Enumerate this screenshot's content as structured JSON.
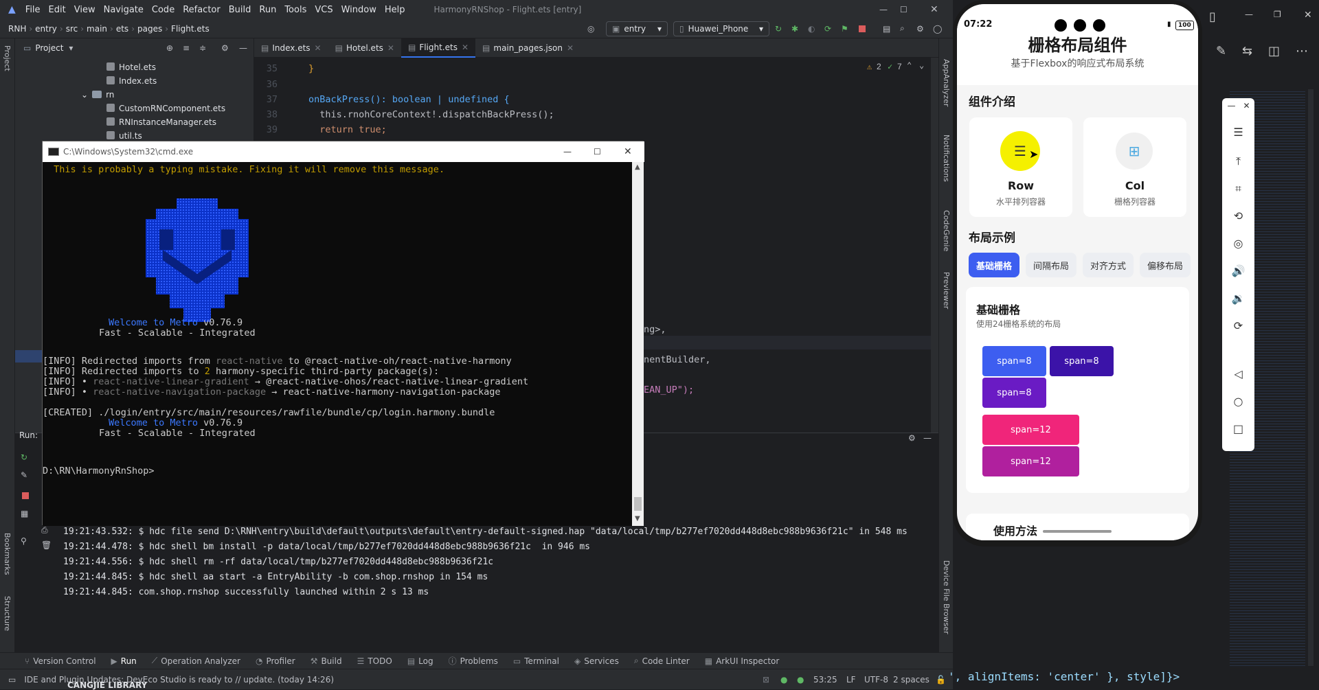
{
  "ide": {
    "window_title": "HarmonyRNShop - Flight.ets [entry]",
    "menu": [
      "File",
      "Edit",
      "View",
      "Navigate",
      "Code",
      "Refactor",
      "Build",
      "Run",
      "Tools",
      "VCS",
      "Window",
      "Help"
    ],
    "breadcrumb": [
      "RNH",
      "entry",
      "src",
      "main",
      "ets",
      "pages",
      "Flight.ets"
    ],
    "run_config": "entry",
    "device": "Huawei_Phone",
    "project_label": "Project",
    "tree": [
      {
        "name": "Hotel.ets",
        "type": "file"
      },
      {
        "name": "Index.ets",
        "type": "file"
      },
      {
        "name": "rn",
        "type": "dir"
      },
      {
        "name": "CustomRNComponent.ets",
        "type": "file"
      },
      {
        "name": "RNInstanceManager.ets",
        "type": "file"
      },
      {
        "name": "util.ts",
        "type": "file"
      }
    ],
    "tabs": [
      "Index.ets",
      "Hotel.ets",
      "Flight.ets",
      "main_pages.json"
    ],
    "active_tab": "Flight.ets",
    "inspection": {
      "warnings": "2",
      "ok": "7"
    },
    "code": [
      {
        "ln": "35",
        "text": "}"
      },
      {
        "ln": "36",
        "text": ""
      },
      {
        "ln": "37",
        "text": "onBackPress(): boolean | undefined {"
      },
      {
        "ln": "38",
        "text": "  this.rnohCoreContext!.dispatchBackPress();"
      },
      {
        "ln": "39",
        "text": "  return true;"
      }
    ],
    "code_fragments": [
      "ng>,",
      "nentBuilder,",
      "EAN_UP\");"
    ],
    "run_label": "Run:",
    "run_log": [
      "19:21:43.532: $ hdc file send D:\\RNH\\entry\\build\\default\\outputs\\default\\entry-default-signed.hap \"data/local/tmp/b277ef7020dd448d8ebc988b9636f21c\" in 548 ms",
      "19:21:44.478: $ hdc shell bm install -p data/local/tmp/b277ef7020dd448d8ebc988b9636f21c  in 946 ms",
      "19:21:44.556: $ hdc shell rm -rf data/local/tmp/b277ef7020dd448d8ebc988b9636f21c",
      "19:21:44.845: $ hdc shell aa start -a EntryAbility -b com.shop.rnshop in 154 ms",
      "19:21:44.845: com.shop.rnshop successfully launched within 2 s 13 ms"
    ],
    "bottom_tabs": [
      "Version Control",
      "Run",
      "Operation Analyzer",
      "Profiler",
      "Build",
      "TODO",
      "Log",
      "Problems",
      "Terminal",
      "Services",
      "Code Linter",
      "ArkUI Inspector"
    ],
    "right_strip": [
      "AppAnalyzer",
      "Notifications",
      "CodeGenie",
      "Previewer",
      "Device File Browser"
    ],
    "left_strip": [
      "Project",
      "Bookmarks",
      "Structure"
    ],
    "status": {
      "message": "IDE and Plugin Updates: DevEco Studio is ready to // update. (today 14:26)",
      "position": "53:25",
      "line_sep": "LF",
      "encoding": "UTF-8",
      "indent": "2 spaces"
    },
    "bottom_fragment": "CANGJIE LIBRARY"
  },
  "cmd": {
    "title": "C:\\Windows\\System32\\cmd.exe",
    "lines": {
      "warn": " This is probably a typing mistake. Fixing it will remove this message.",
      "welcome1_a": "Welcome to Metro",
      "welcome1_b": " v0.76.9",
      "fast1": "Fast - Scalable - Integrated",
      "info1_a": "[INFO] Redirected imports from ",
      "info1_b": "react-native",
      "info1_c": " to @react-native-oh/react-native-harmony",
      "info2_a": "[INFO] Redirected imports to ",
      "info2_b": "2",
      "info2_c": " harmony-specific third-party package(s):",
      "info3_a": "[INFO] • ",
      "info3_b": "react-native-linear-gradient",
      "info3_c": " → @react-native-ohos/react-native-linear-gradient",
      "info4_a": "[INFO] • ",
      "info4_b": "react-native-navigation-package",
      "info4_c": " → react-native-harmony-navigation-package",
      "created": "[CREATED] ./login/entry/src/main/resources/rawfile/bundle/cp/login.harmony.bundle",
      "welcome2_a": "Welcome to Metro",
      "welcome2_b": " v0.76.9",
      "fast2": "Fast - Scalable - Integrated",
      "prompt": "D:\\RN\\HarmonyRnShop>"
    }
  },
  "phone": {
    "time": "07:22",
    "battery": "100",
    "title": "栅格布局组件",
    "subtitle": "基于Flexbox的响应式布局系统",
    "intro_heading": "组件介绍",
    "intro_cards": [
      {
        "name": "Row",
        "desc": "水平排列容器"
      },
      {
        "name": "Col",
        "desc": "栅格列容器"
      }
    ],
    "examples_heading": "布局示例",
    "segments": [
      "基础栅格",
      "间隔布局",
      "对齐方式",
      "偏移布局"
    ],
    "active_segment": "基础栅格",
    "demo_title": "基础栅格",
    "demo_desc": "使用24栅格系统的布局",
    "blocks": [
      {
        "label": "span=8",
        "color": "#3d5ef0"
      },
      {
        "label": "span=8",
        "color": "#3b13a8"
      },
      {
        "label": "span=8",
        "color": "#6a1bc4"
      },
      {
        "label": "span=12",
        "color": "#f0257a"
      },
      {
        "label": "span=12",
        "color": "#b0209e"
      }
    ],
    "usage_heading": "使用方法"
  },
  "desktop": {
    "code_fragment": "', alignItems: 'center' }, style]}>"
  },
  "colors": {
    "accent": "#3574f0",
    "segment_active": "#3d5ef0",
    "row_icon_bg": "#f5f000"
  }
}
